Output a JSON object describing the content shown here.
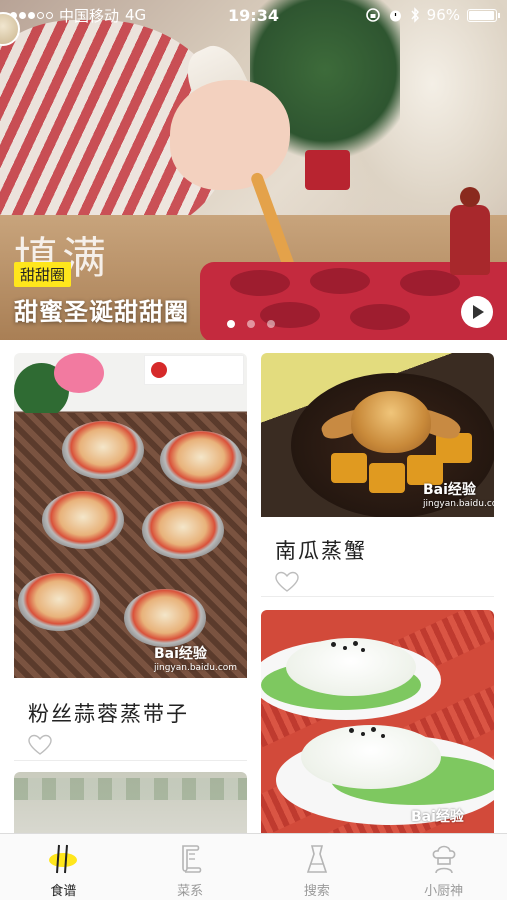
{
  "status_bar": {
    "carrier": "中国移动",
    "network": "4G",
    "time": "19:34",
    "battery": "96%",
    "battery_level": 0.96
  },
  "hero": {
    "decor_text": "填满",
    "tag": "甜甜圈",
    "title": "甜蜜圣诞甜甜圈",
    "slide_count": 3,
    "active_slide": 0
  },
  "feed": {
    "items": [
      {
        "title": "粉丝蒜蓉蒸带子",
        "watermark": "Bai",
        "watermark_tail": "经验",
        "watermark_url": "jingyan.baidu.com"
      },
      {
        "title": "南瓜蒸蟹",
        "watermark": "Bai",
        "watermark_tail": "经验",
        "watermark_url": "jingyan.baidu.com"
      },
      {
        "title": "",
        "watermark": "Bai",
        "watermark_tail": "经验"
      },
      {
        "title": ""
      }
    ]
  },
  "tab_bar": {
    "tabs": [
      {
        "label": "食谱",
        "icon": "chopsticks-icon",
        "active": true
      },
      {
        "label": "菜系",
        "icon": "scroll-icon",
        "active": false
      },
      {
        "label": "搜索",
        "icon": "search-icon",
        "active": false
      },
      {
        "label": "小厨神",
        "icon": "chef-hat-icon",
        "active": false
      }
    ]
  },
  "colors": {
    "tag_bg": "#ffe61c",
    "tab_active": "#222222",
    "tab_inactive": "#9a9a9a"
  }
}
